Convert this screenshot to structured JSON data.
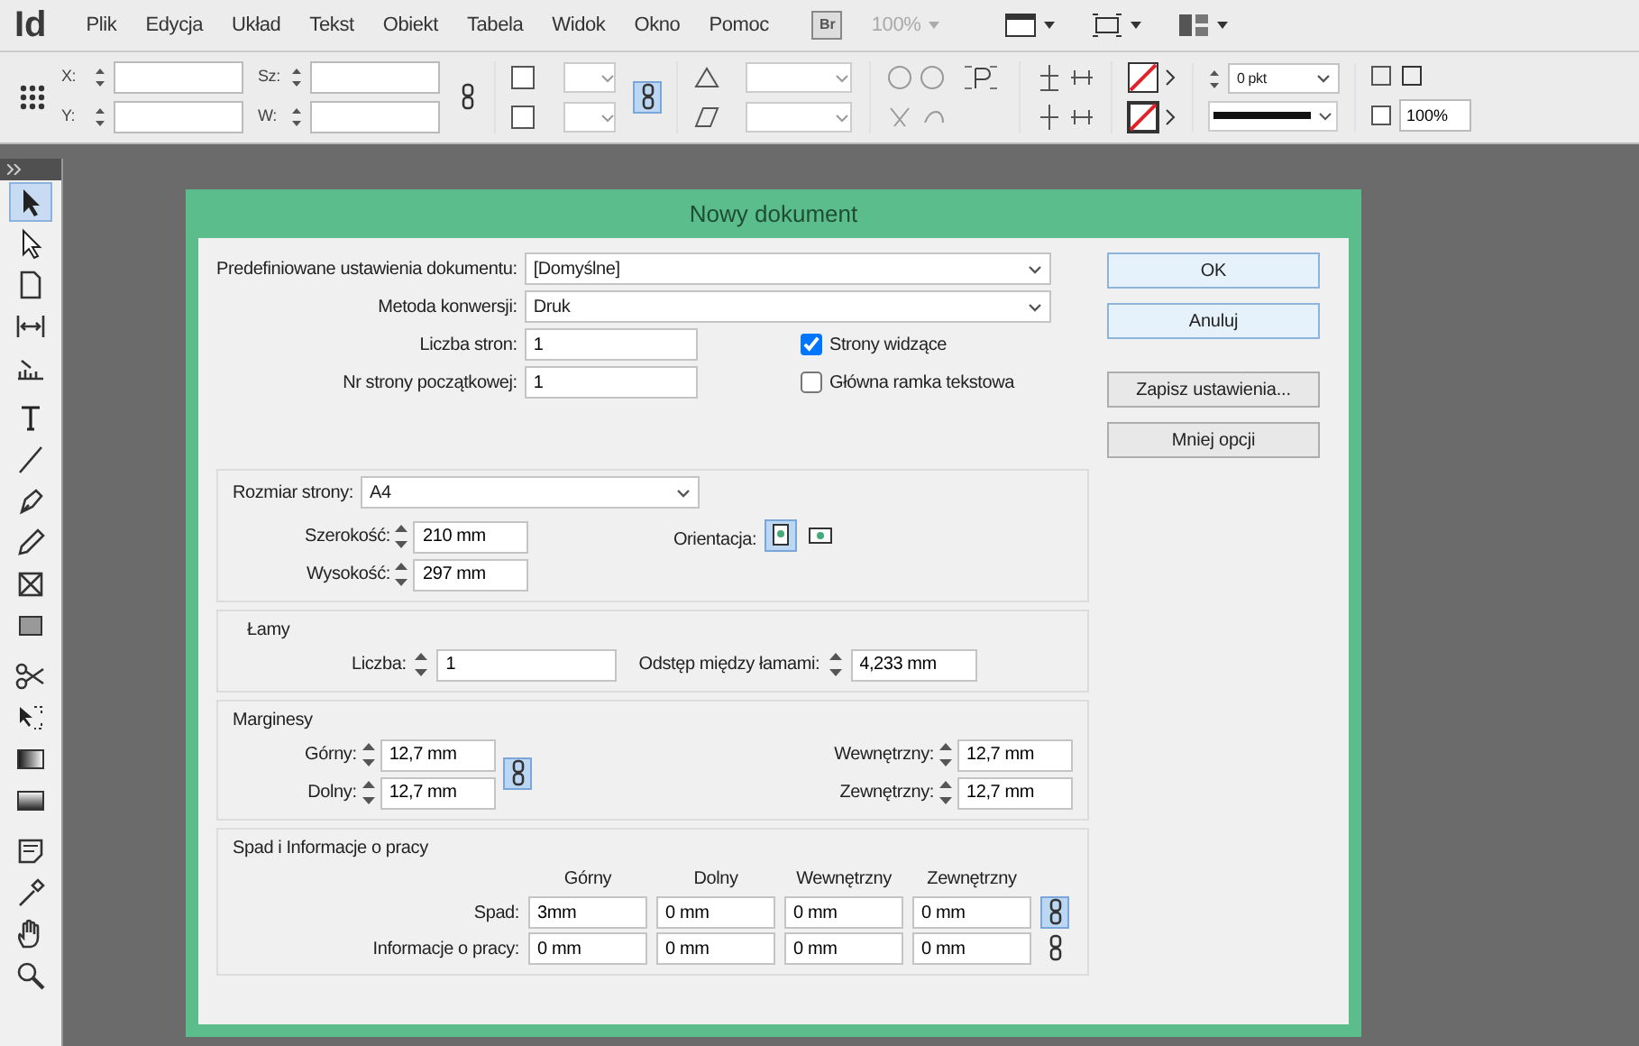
{
  "app": {
    "logo": "Id",
    "menu": [
      "Plik",
      "Edycja",
      "Układ",
      "Tekst",
      "Obiekt",
      "Tabela",
      "Widok",
      "Okno",
      "Pomoc"
    ],
    "bridge": "Br",
    "zoom": "100%"
  },
  "control_panel": {
    "x_label": "X:",
    "y_label": "Y:",
    "w_label": "Sz:",
    "h_label": "W:",
    "stroke_weight": "0 pkt",
    "opacity": "100%"
  },
  "toolbar": {
    "tools": [
      {
        "selected": true
      },
      {
        "selected": false
      },
      {
        "selected": false
      },
      {
        "selected": false
      },
      {
        "selected": false
      },
      {
        "selected": false
      },
      {
        "selected": false
      },
      {
        "selected": false
      },
      {
        "selected": false
      },
      {
        "selected": false
      },
      {
        "selected": false
      },
      {
        "selected": false
      },
      {
        "selected": false
      },
      {
        "selected": false
      },
      {
        "selected": false
      },
      {
        "selected": false
      },
      {
        "selected": false
      },
      {
        "selected": false
      },
      {
        "selected": false
      }
    ]
  },
  "dialog": {
    "title": "Nowy dokument",
    "preset": {
      "label": "Predefiniowane ustawienia dokumentu:",
      "value": "[Domyślne]"
    },
    "intent": {
      "label": "Metoda konwersji:",
      "value": "Druk"
    },
    "pages": {
      "label": "Liczba stron:",
      "value": "1"
    },
    "start_page": {
      "label": "Nr strony początkowej:",
      "value": "1"
    },
    "checkboxes": [
      {
        "label": "Strony widzące",
        "checked": true
      },
      {
        "label": "Główna ramka tekstowa",
        "checked": false
      }
    ],
    "page_size": {
      "label": "Rozmiar strony:",
      "value": "A4",
      "width_label": "Szerokość:",
      "width": "210 mm",
      "height_label": "Wysokość:",
      "height": "297 mm",
      "orientation_label": "Orientacja:",
      "orientations": [
        {
          "kind": "portrait",
          "selected": true
        },
        {
          "kind": "landscape",
          "selected": false
        }
      ]
    },
    "columns": {
      "legend": "Łamy",
      "number_label": "Liczba:",
      "number": "1",
      "gutter_label": "Odstęp między łamami:",
      "gutter": "4,233 mm"
    },
    "margins": {
      "legend": "Marginesy",
      "linked": true,
      "fields": [
        {
          "label": "Górny:",
          "value": "12,7 mm"
        },
        {
          "label": "Dolny:",
          "value": "12,7 mm"
        },
        {
          "label": "Wewnętrzny:",
          "value": "12,7 mm"
        },
        {
          "label": "Zewnętrzny:",
          "value": "12,7 mm"
        }
      ]
    },
    "bleed": {
      "legend": "Spad i Informacje o pracy",
      "columns": [
        "Górny",
        "Dolny",
        "Wewnętrzny",
        "Zewnętrzny"
      ],
      "rows": [
        {
          "label": "Spad:",
          "values": [
            "3mm",
            "0 mm",
            "0 mm",
            "0 mm"
          ],
          "linked": true
        },
        {
          "label": "Informacje o pracy:",
          "values": [
            "0 mm",
            "0 mm",
            "0 mm",
            "0 mm"
          ],
          "linked": false
        }
      ]
    },
    "buttons": [
      {
        "label": "OK",
        "highlighted": true
      },
      {
        "label": "Anuluj",
        "highlighted": true
      },
      {
        "label": "Zapisz ustawienia...",
        "highlighted": false
      },
      {
        "label": "Mniej opcji",
        "highlighted": false
      }
    ]
  }
}
